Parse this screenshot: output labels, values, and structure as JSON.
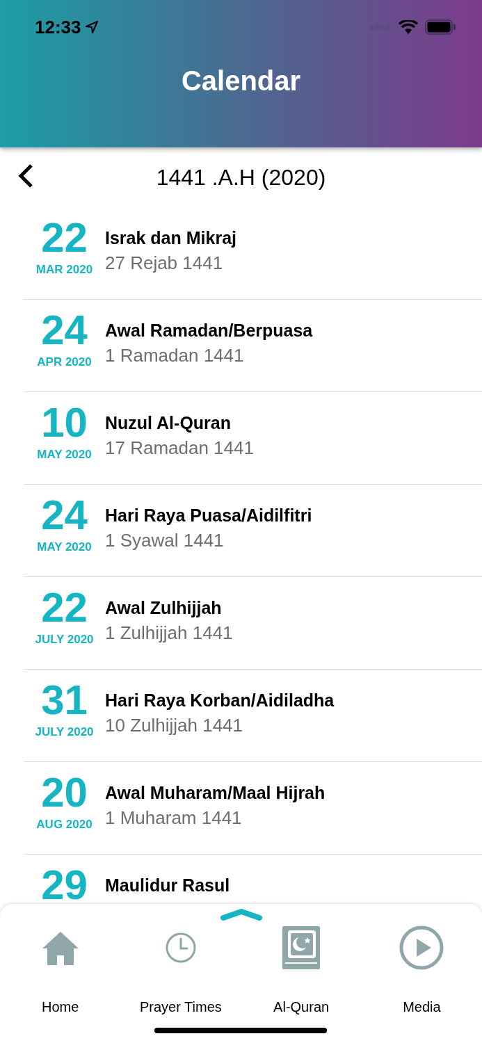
{
  "status_bar": {
    "time": "12:33"
  },
  "header": {
    "title": "Calendar"
  },
  "year_bar": {
    "title": "1441 .A.H (2020)"
  },
  "events": [
    {
      "day": "22",
      "month": "MAR 2020",
      "title": "Israk dan Mikraj",
      "hijri": "27 Rejab 1441"
    },
    {
      "day": "24",
      "month": "APR 2020",
      "title": "Awal Ramadan/Berpuasa",
      "hijri": "1 Ramadan 1441"
    },
    {
      "day": "10",
      "month": "MAY 2020",
      "title": "Nuzul Al-Quran",
      "hijri": "17 Ramadan 1441"
    },
    {
      "day": "24",
      "month": "MAY 2020",
      "title": "Hari Raya Puasa/Aidilfitri",
      "hijri": "1 Syawal 1441"
    },
    {
      "day": "22",
      "month": "JULY 2020",
      "title": "Awal Zulhijjah",
      "hijri": "1 Zulhijjah 1441"
    },
    {
      "day": "31",
      "month": "JULY 2020",
      "title": "Hari Raya Korban/Aidiladha",
      "hijri": "10 Zulhijjah 1441"
    },
    {
      "day": "20",
      "month": "AUG 2020",
      "title": "Awal Muharam/Maal Hijrah",
      "hijri": "1 Muharam 1441"
    },
    {
      "day": "29",
      "title": "Maulidur Rasul"
    }
  ],
  "tab_bar": {
    "items": [
      {
        "kind": "home",
        "label": "Home"
      },
      {
        "kind": "clock",
        "label": "Prayer Times"
      },
      {
        "kind": "quran",
        "label": "Al-Quran"
      },
      {
        "kind": "media",
        "label": "Media"
      }
    ]
  }
}
